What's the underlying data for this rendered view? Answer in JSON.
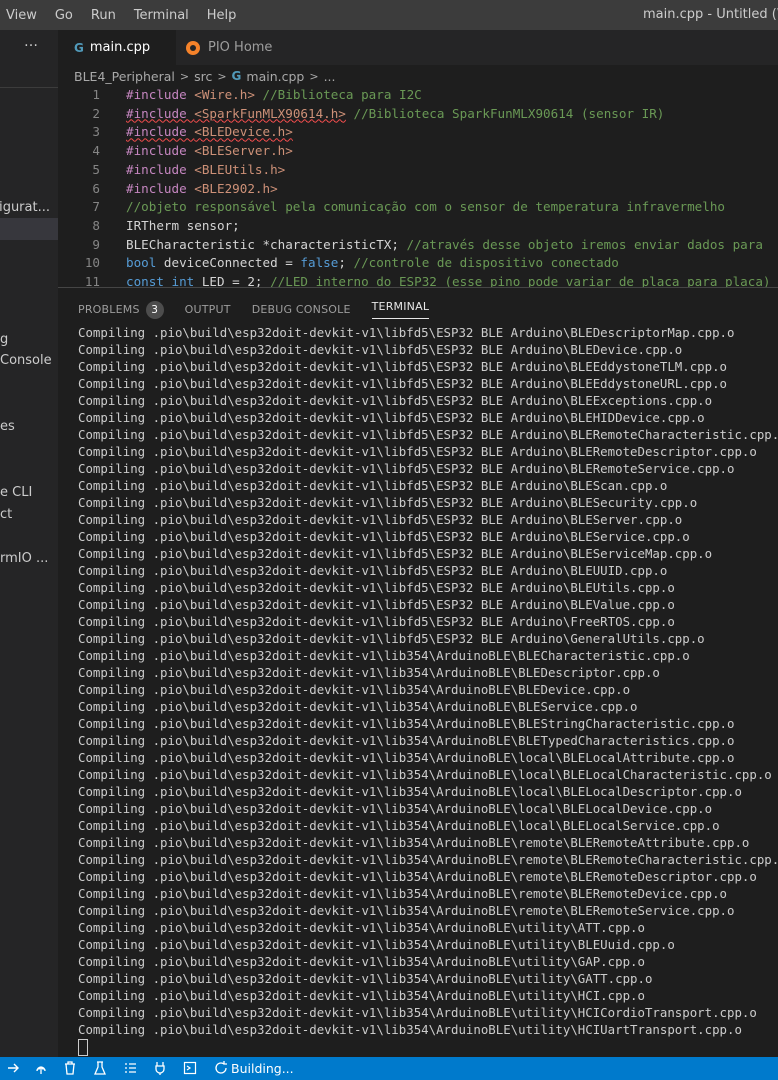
{
  "menu": {
    "items": [
      "View",
      "Go",
      "Run",
      "Terminal",
      "Help"
    ],
    "window_title": "main.cpp - Untitled (Work"
  },
  "sidebar": {
    "more_icon": "…",
    "items": [
      "figurat...",
      "g",
      "Console",
      "es",
      "e CLI",
      "ct",
      "rmIO ..."
    ]
  },
  "tabs": [
    {
      "label": "main.cpp",
      "icon": "cpp-file-icon",
      "active": true
    },
    {
      "label": "PIO Home",
      "icon": "platformio-icon",
      "active": false
    }
  ],
  "breadcrumb": [
    "BLE4_Peripheral",
    "src",
    "main.cpp",
    "..."
  ],
  "editor": {
    "lines": [
      {
        "n": "1",
        "parts": [
          [
            "kw",
            "#include "
          ],
          [
            "inc",
            "<Wire.h>"
          ],
          [
            "cm",
            " //Biblioteca para I2C"
          ]
        ]
      },
      {
        "n": "2",
        "parts": [
          [
            "kw sq",
            "#include "
          ],
          [
            "inc sq",
            "<SparkFunMLX90614.h>"
          ],
          [
            "cm",
            " //Biblioteca SparkFunMLX90614 (sensor IR)"
          ]
        ]
      },
      {
        "n": "3",
        "parts": [
          [
            "kw sq",
            "#include "
          ],
          [
            "inc sq",
            "<BLEDevice.h>"
          ]
        ]
      },
      {
        "n": "4",
        "parts": [
          [
            "kw",
            "#include "
          ],
          [
            "inc",
            "<BLEServer.h>"
          ]
        ]
      },
      {
        "n": "5",
        "parts": [
          [
            "kw",
            "#include "
          ],
          [
            "inc",
            "<BLEUtils.h>"
          ]
        ]
      },
      {
        "n": "6",
        "parts": [
          [
            "kw",
            "#include "
          ],
          [
            "inc",
            "<BLE2902.h>"
          ]
        ]
      },
      {
        "n": "7",
        "parts": [
          [
            "cm",
            "//objeto responsável pela comunicação com o sensor de temperatura infravermelho"
          ]
        ]
      },
      {
        "n": "8",
        "parts": [
          [
            "tx",
            "IRTherm sensor;"
          ]
        ]
      },
      {
        "n": "9",
        "parts": [
          [
            "tx",
            "BLECharacteristic *characteristicTX; "
          ],
          [
            "cm",
            "//através desse objeto iremos enviar dados para"
          ]
        ]
      },
      {
        "n": "10",
        "parts": [
          [
            "bl",
            "bool"
          ],
          [
            "tx",
            " deviceConnected = "
          ],
          [
            "bl",
            "false"
          ],
          [
            "tx",
            "; "
          ],
          [
            "cm",
            "//controle de dispositivo conectado"
          ]
        ]
      },
      {
        "n": "11",
        "parts": [
          [
            "bl",
            "const int"
          ],
          [
            "tx",
            " LED = 2; "
          ],
          [
            "cm",
            "//LED interno do ESP32 (esse pino pode variar de placa para placa)"
          ]
        ]
      }
    ]
  },
  "panel": {
    "tabs": [
      {
        "label": "PROBLEMS",
        "badge": "3",
        "active": false
      },
      {
        "label": "OUTPUT",
        "active": false
      },
      {
        "label": "DEBUG CONSOLE",
        "active": false
      },
      {
        "label": "TERMINAL",
        "active": true
      }
    ],
    "terminal_lines": [
      "Compiling .pio\\build\\esp32doit-devkit-v1\\libfd5\\ESP32 BLE Arduino\\BLEDescriptorMap.cpp.o",
      "Compiling .pio\\build\\esp32doit-devkit-v1\\libfd5\\ESP32 BLE Arduino\\BLEDevice.cpp.o",
      "Compiling .pio\\build\\esp32doit-devkit-v1\\libfd5\\ESP32 BLE Arduino\\BLEEddystoneTLM.cpp.o",
      "Compiling .pio\\build\\esp32doit-devkit-v1\\libfd5\\ESP32 BLE Arduino\\BLEEddystoneURL.cpp.o",
      "Compiling .pio\\build\\esp32doit-devkit-v1\\libfd5\\ESP32 BLE Arduino\\BLEExceptions.cpp.o",
      "Compiling .pio\\build\\esp32doit-devkit-v1\\libfd5\\ESP32 BLE Arduino\\BLEHIDDevice.cpp.o",
      "Compiling .pio\\build\\esp32doit-devkit-v1\\libfd5\\ESP32 BLE Arduino\\BLERemoteCharacteristic.cpp.o",
      "Compiling .pio\\build\\esp32doit-devkit-v1\\libfd5\\ESP32 BLE Arduino\\BLERemoteDescriptor.cpp.o",
      "Compiling .pio\\build\\esp32doit-devkit-v1\\libfd5\\ESP32 BLE Arduino\\BLERemoteService.cpp.o",
      "Compiling .pio\\build\\esp32doit-devkit-v1\\libfd5\\ESP32 BLE Arduino\\BLEScan.cpp.o",
      "Compiling .pio\\build\\esp32doit-devkit-v1\\libfd5\\ESP32 BLE Arduino\\BLESecurity.cpp.o",
      "Compiling .pio\\build\\esp32doit-devkit-v1\\libfd5\\ESP32 BLE Arduino\\BLEServer.cpp.o",
      "Compiling .pio\\build\\esp32doit-devkit-v1\\libfd5\\ESP32 BLE Arduino\\BLEService.cpp.o",
      "Compiling .pio\\build\\esp32doit-devkit-v1\\libfd5\\ESP32 BLE Arduino\\BLEServiceMap.cpp.o",
      "Compiling .pio\\build\\esp32doit-devkit-v1\\libfd5\\ESP32 BLE Arduino\\BLEUUID.cpp.o",
      "Compiling .pio\\build\\esp32doit-devkit-v1\\libfd5\\ESP32 BLE Arduino\\BLEUtils.cpp.o",
      "Compiling .pio\\build\\esp32doit-devkit-v1\\libfd5\\ESP32 BLE Arduino\\BLEValue.cpp.o",
      "Compiling .pio\\build\\esp32doit-devkit-v1\\libfd5\\ESP32 BLE Arduino\\FreeRTOS.cpp.o",
      "Compiling .pio\\build\\esp32doit-devkit-v1\\libfd5\\ESP32 BLE Arduino\\GeneralUtils.cpp.o",
      "Compiling .pio\\build\\esp32doit-devkit-v1\\lib354\\ArduinoBLE\\BLECharacteristic.cpp.o",
      "Compiling .pio\\build\\esp32doit-devkit-v1\\lib354\\ArduinoBLE\\BLEDescriptor.cpp.o",
      "Compiling .pio\\build\\esp32doit-devkit-v1\\lib354\\ArduinoBLE\\BLEDevice.cpp.o",
      "Compiling .pio\\build\\esp32doit-devkit-v1\\lib354\\ArduinoBLE\\BLEService.cpp.o",
      "Compiling .pio\\build\\esp32doit-devkit-v1\\lib354\\ArduinoBLE\\BLEStringCharacteristic.cpp.o",
      "Compiling .pio\\build\\esp32doit-devkit-v1\\lib354\\ArduinoBLE\\BLETypedCharacteristics.cpp.o",
      "Compiling .pio\\build\\esp32doit-devkit-v1\\lib354\\ArduinoBLE\\local\\BLELocalAttribute.cpp.o",
      "Compiling .pio\\build\\esp32doit-devkit-v1\\lib354\\ArduinoBLE\\local\\BLELocalCharacteristic.cpp.o",
      "Compiling .pio\\build\\esp32doit-devkit-v1\\lib354\\ArduinoBLE\\local\\BLELocalDescriptor.cpp.o",
      "Compiling .pio\\build\\esp32doit-devkit-v1\\lib354\\ArduinoBLE\\local\\BLELocalDevice.cpp.o",
      "Compiling .pio\\build\\esp32doit-devkit-v1\\lib354\\ArduinoBLE\\local\\BLELocalService.cpp.o",
      "Compiling .pio\\build\\esp32doit-devkit-v1\\lib354\\ArduinoBLE\\remote\\BLERemoteAttribute.cpp.o",
      "Compiling .pio\\build\\esp32doit-devkit-v1\\lib354\\ArduinoBLE\\remote\\BLERemoteCharacteristic.cpp.o",
      "Compiling .pio\\build\\esp32doit-devkit-v1\\lib354\\ArduinoBLE\\remote\\BLERemoteDescriptor.cpp.o",
      "Compiling .pio\\build\\esp32doit-devkit-v1\\lib354\\ArduinoBLE\\remote\\BLERemoteDevice.cpp.o",
      "Compiling .pio\\build\\esp32doit-devkit-v1\\lib354\\ArduinoBLE\\remote\\BLERemoteService.cpp.o",
      "Compiling .pio\\build\\esp32doit-devkit-v1\\lib354\\ArduinoBLE\\utility\\ATT.cpp.o",
      "Compiling .pio\\build\\esp32doit-devkit-v1\\lib354\\ArduinoBLE\\utility\\BLEUuid.cpp.o",
      "Compiling .pio\\build\\esp32doit-devkit-v1\\lib354\\ArduinoBLE\\utility\\GAP.cpp.o",
      "Compiling .pio\\build\\esp32doit-devkit-v1\\lib354\\ArduinoBLE\\utility\\GATT.cpp.o",
      "Compiling .pio\\build\\esp32doit-devkit-v1\\lib354\\ArduinoBLE\\utility\\HCI.cpp.o",
      "Compiling .pio\\build\\esp32doit-devkit-v1\\lib354\\ArduinoBLE\\utility\\HCICordioTransport.cpp.o",
      "Compiling .pio\\build\\esp32doit-devkit-v1\\lib354\\ArduinoBLE\\utility\\HCIUartTransport.cpp.o"
    ]
  },
  "statusbar": {
    "icons": [
      "build-check-icon",
      "upload-arrow-icon",
      "clean-trash-icon",
      "test-flask-icon",
      "serial-monitor-icon",
      "plug-icon",
      "terminal-icon",
      "sync-icon"
    ],
    "status_text": "Building...",
    "color": "#007acc"
  },
  "colors": {
    "keyword": "#c586c0",
    "string": "#ce9178",
    "comment": "#6a9955",
    "type": "#569cd6",
    "background": "#1e1e1e"
  }
}
